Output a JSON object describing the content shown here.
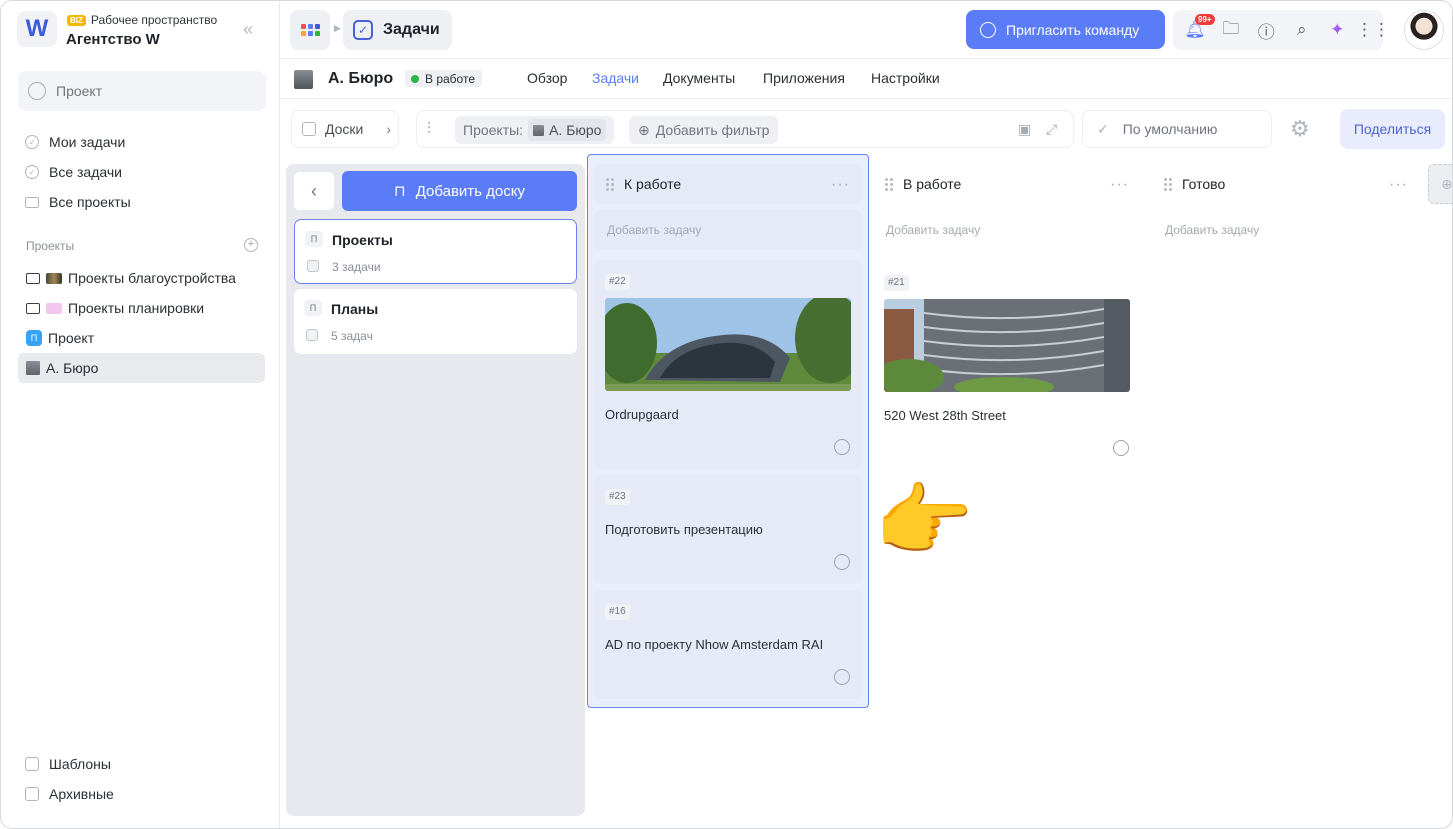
{
  "workspace": {
    "logo_letter": "W",
    "badge": "BIZ",
    "subtitle": "Рабочее пространство",
    "name": "Агентство W",
    "collapse_glyph": "«"
  },
  "sidebar": {
    "search_placeholder": "Проект",
    "nav": [
      {
        "label": "Мои задачи",
        "icon": "check-circle-icon"
      },
      {
        "label": "Все задачи",
        "icon": "check-circle-icon"
      },
      {
        "label": "Все проекты",
        "icon": "folder-icon"
      }
    ],
    "projects_title": "Проекты",
    "projects": [
      {
        "label": "Проекты благоустройства",
        "icon": "folder-icon"
      },
      {
        "label": "Проекты планировки",
        "icon": "folder-icon"
      },
      {
        "label": "Проект",
        "icon": "project-badge-icon",
        "badge": "П"
      },
      {
        "label": "А. Бюро",
        "icon": "building-icon",
        "active": true
      }
    ],
    "bottom": [
      {
        "label": "Шаблоны",
        "icon": "templates-icon"
      },
      {
        "label": "Архивные",
        "icon": "archive-icon"
      }
    ]
  },
  "topbar": {
    "breadcrumb_title": "Задачи",
    "invite_label": "Пригласить команду",
    "notifications_badge": "99+",
    "icons": [
      "bell-icon",
      "folder-icon",
      "help-icon",
      "search-icon",
      "sparkle-icon",
      "grid-icon"
    ]
  },
  "project": {
    "title": "А. Бюро",
    "status": "В работе",
    "status_color": "#2fb24c",
    "tabs": [
      {
        "label": "Обзор",
        "active": false
      },
      {
        "label": "Задачи",
        "active": true
      },
      {
        "label": "Документы",
        "active": false
      },
      {
        "label": "Приложения",
        "active": false
      },
      {
        "label": "Настройки",
        "active": false
      }
    ]
  },
  "toolbar": {
    "boards_label": "Доски",
    "filter_projects_label": "Проекты:",
    "filter_project_value": "А. Бюро",
    "add_filter_label": "Добавить фильтр",
    "view_label": "По умолчанию",
    "share_label": "Поделиться"
  },
  "boards": {
    "add_board_label": "Добавить доску",
    "items": [
      {
        "badge": "П",
        "title": "Проекты",
        "count": "3 задачи"
      },
      {
        "badge": "П",
        "title": "Планы",
        "count": "5 задач"
      }
    ]
  },
  "columns": [
    {
      "title": "К работе",
      "add_task": "Добавить задачу",
      "tasks": [
        {
          "id": "#22",
          "title": "Ordrupgaard",
          "has_image": true
        },
        {
          "id": "#23",
          "title": "Подготовить презентацию",
          "has_image": false
        },
        {
          "id": "#16",
          "title": "AD по проекту Nhow Amsterdam RAI",
          "has_image": false
        }
      ]
    },
    {
      "title": "В работе",
      "add_task": "Добавить задачу",
      "tasks": [
        {
          "id": "#21",
          "title": "520 West 28th Street",
          "has_image": true
        }
      ]
    },
    {
      "title": "Готово",
      "add_task": "Добавить задачу",
      "tasks": []
    }
  ],
  "colors": {
    "accent": "#5b7cf7",
    "selection_border": "#6a83ee",
    "notification": "#ef3b3b"
  }
}
